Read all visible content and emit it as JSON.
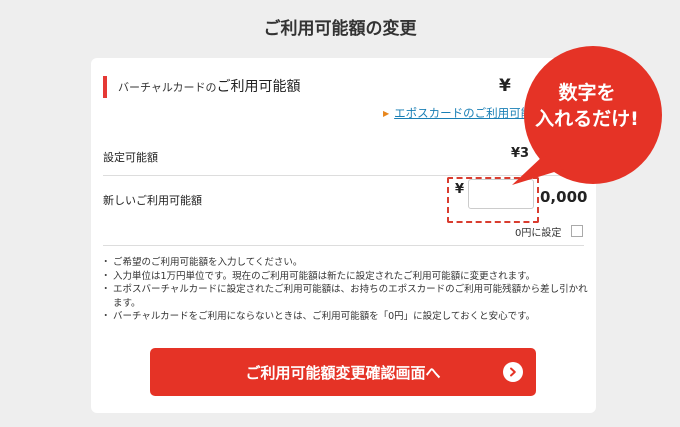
{
  "page_title": "ご利用可能額の変更",
  "section": {
    "title_small": "バーチャルカードの",
    "title_large": "ご利用可能額",
    "yen_symbol": "¥"
  },
  "link": {
    "label": "エポスカードのご利用可能額"
  },
  "current_setting": {
    "label": "設定可能額",
    "value": "¥3"
  },
  "new_amount": {
    "label": "新しいご利用可能額",
    "yen_symbol": "¥",
    "input_value": "",
    "tail_text": "0,000"
  },
  "zero_option": {
    "label": "0円に設定"
  },
  "notes": [
    "ご希望のご利用可能額を入力してください。",
    "入力単位は1万円単位です。現在のご利用可能額は新たに設定されたご利用可能額に変更されます。",
    "エポスバーチャルカードに設定されたご利用可能額は、お持ちのエポスカードのご利用可能残額から差し引かれます。",
    "バーチャルカードをご利用にならないときは、ご利用可能額を「0円」に設定しておくと安心です。"
  ],
  "cta": {
    "label": "ご利用可能額変更確認画面へ"
  },
  "callout": {
    "line1": "数字を",
    "line2": "入れるだけ!"
  },
  "colors": {
    "accent_red": "#e53326",
    "link_blue": "#1a7fb5",
    "link_arrow_orange": "#e8861c",
    "highlight_dash": "#d93c2f"
  }
}
